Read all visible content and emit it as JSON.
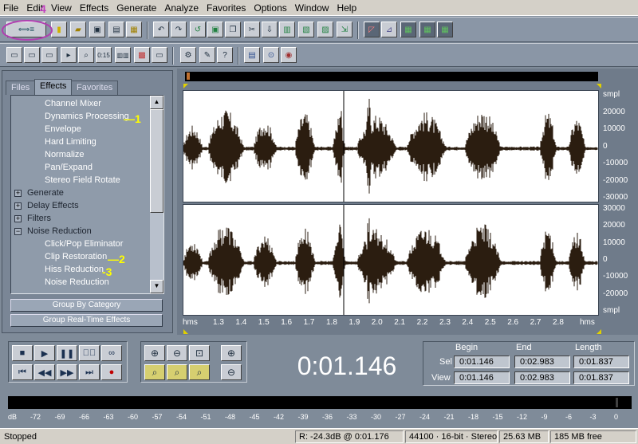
{
  "menu": [
    "File",
    "Edit",
    "View",
    "Effects",
    "Generate",
    "Analyze",
    "Favorites",
    "Options",
    "Window",
    "Help"
  ],
  "panel": {
    "tabs": [
      "Files",
      "Effects",
      "Favorites"
    ],
    "tree": [
      {
        "label": "Channel Mixer",
        "type": "leaf"
      },
      {
        "label": "Dynamics Processing",
        "type": "leaf"
      },
      {
        "label": "Envelope",
        "type": "leaf"
      },
      {
        "label": "Hard Limiting",
        "type": "leaf"
      },
      {
        "label": "Normalize",
        "type": "leaf"
      },
      {
        "label": "Pan/Expand",
        "type": "leaf"
      },
      {
        "label": "Stereo Field Rotate",
        "type": "leaf"
      },
      {
        "label": "Generate",
        "type": "cat",
        "box": "+"
      },
      {
        "label": "Delay Effects",
        "type": "cat",
        "box": "+"
      },
      {
        "label": "Filters",
        "type": "cat",
        "box": "+"
      },
      {
        "label": "Noise Reduction",
        "type": "cat",
        "box": "−"
      },
      {
        "label": "Click/Pop Eliminator",
        "type": "leaf"
      },
      {
        "label": "Clip Restoration",
        "type": "leaf"
      },
      {
        "label": "Hiss Reduction",
        "type": "leaf"
      },
      {
        "label": "Noise Reduction",
        "type": "leaf"
      }
    ],
    "group_by_category": "Group By Category",
    "group_realtime": "Group Real-Time Effects"
  },
  "annotations": {
    "a1": "—1",
    "a2": "—2",
    "a3": "-3",
    "a4": "4"
  },
  "amp_scale_top": [
    "smpl",
    "20000",
    "10000",
    "0",
    "-10000",
    "-20000",
    "-30000"
  ],
  "amp_scale_bottom": [
    "30000",
    "20000",
    "10000",
    "0",
    "-10000",
    "-20000",
    "smpl"
  ],
  "time_scale": [
    "hms",
    "1.3",
    "1.4",
    "1.5",
    "1.6",
    "1.7",
    "1.8",
    "1.9",
    "2.0",
    "2.1",
    "2.2",
    "2.3",
    "2.4",
    "2.5",
    "2.6",
    "2.7",
    "2.8",
    "hms"
  ],
  "time_display": "0:01.146",
  "selection": {
    "headers": [
      "Begin",
      "End",
      "Length"
    ],
    "sel_label": "Sel",
    "view_label": "View",
    "sel": [
      "0:01.146",
      "0:02.983",
      "0:01.837"
    ],
    "view": [
      "0:01.146",
      "0:02.983",
      "0:01.837"
    ]
  },
  "db_scale": [
    "dB",
    "-72",
    "-69",
    "-66",
    "-63",
    "-60",
    "-57",
    "-54",
    "-51",
    "-48",
    "-45",
    "-42",
    "-39",
    "-36",
    "-33",
    "-30",
    "-27",
    "-24",
    "-21",
    "-18",
    "-15",
    "-12",
    "-9",
    "-6",
    "-3",
    "0"
  ],
  "status": {
    "state": "Stopped",
    "level": "R: -24.3dB @  0:01.176",
    "format": "44100 · 16-bit · Stereo",
    "size": "25.63 MB",
    "free": "185 MB free"
  },
  "colors": {
    "waveform": "#2b1d10",
    "annotation": "#ffff00",
    "annotation_circle": "#b040b0"
  }
}
